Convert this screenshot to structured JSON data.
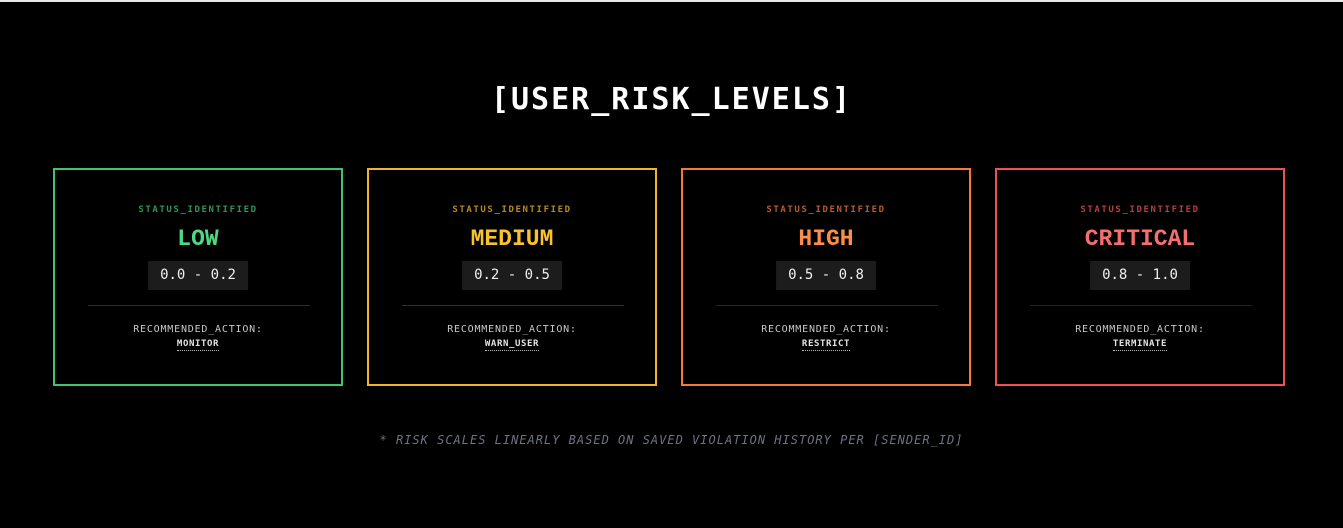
{
  "title": "[USER_RISK_LEVELS]",
  "cards": [
    {
      "status": "STATUS_IDENTIFIED",
      "level": "LOW",
      "range": "0.0 - 0.2",
      "action_label": "RECOMMENDED_ACTION:",
      "action": "MONITOR",
      "color": "#3ec46d"
    },
    {
      "status": "STATUS_IDENTIFIED",
      "level": "MEDIUM",
      "range": "0.2 - 0.5",
      "action_label": "RECOMMENDED_ACTION:",
      "action": "WARN_USER",
      "color": "#f0b62a"
    },
    {
      "status": "STATUS_IDENTIFIED",
      "level": "HIGH",
      "range": "0.5 - 0.8",
      "action_label": "RECOMMENDED_ACTION:",
      "action": "RESTRICT",
      "color": "#f5793b"
    },
    {
      "status": "STATUS_IDENTIFIED",
      "level": "CRITICAL",
      "range": "0.8 - 1.0",
      "action_label": "RECOMMENDED_ACTION:",
      "action": "TERMINATE",
      "color": "#ef5050"
    }
  ],
  "footnote": "* RISK SCALES LINEARLY BASED ON SAVED VIOLATION HISTORY PER [SENDER_ID]"
}
